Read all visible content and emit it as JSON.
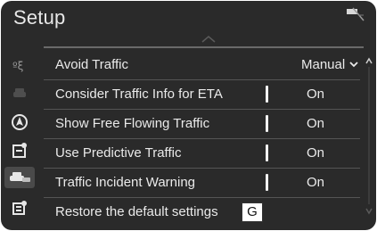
{
  "header": {
    "title": "Setup",
    "status_icon": "signal-off-icon"
  },
  "sidebar": {
    "items": [
      {
        "icon": "route-icon"
      },
      {
        "icon": "car-icon"
      },
      {
        "icon": "navigation-icon"
      },
      {
        "icon": "display-settings-icon"
      },
      {
        "icon": "traffic-icon",
        "active": true
      },
      {
        "icon": "map-data-icon"
      }
    ]
  },
  "settings": {
    "rows": [
      {
        "label": "Avoid Traffic",
        "value": "Manual",
        "type": "dropdown"
      },
      {
        "label": "Consider Traffic Info for ETA",
        "value": "On",
        "type": "toggle"
      },
      {
        "label": "Show Free Flowing Traffic",
        "value": "On",
        "type": "toggle"
      },
      {
        "label": "Use Predictive Traffic",
        "value": "On",
        "type": "toggle"
      },
      {
        "label": "Traffic Incident Warning",
        "value": "On",
        "type": "toggle"
      },
      {
        "label": "Restore the default settings",
        "badge": "G",
        "type": "action"
      }
    ]
  },
  "colors": {
    "background": "#2a2a2a",
    "text": "#eaeaea",
    "divider": "#555555"
  }
}
